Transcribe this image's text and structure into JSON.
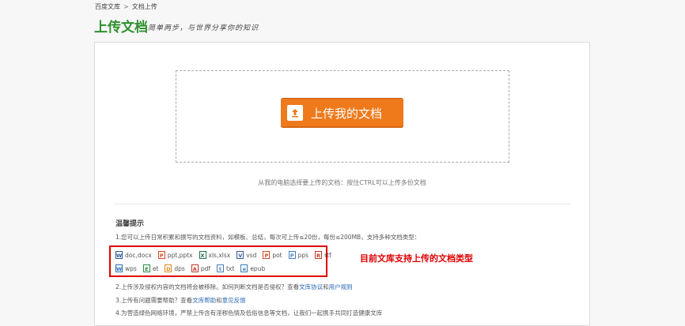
{
  "breadcrumb": {
    "home": "百度文库",
    "separator": ">",
    "current": "文档上传"
  },
  "header": {
    "title": "上传文档",
    "slogan": "简单两步，与世界分享你的知识"
  },
  "upload": {
    "button_label": "上传我的文档",
    "button_icon": "upload-arrow-icon",
    "instruction": "从我的电脑选择要上传的文档：按住CTRL可以上传多份文档"
  },
  "tips": {
    "heading": "温馨提示",
    "line1": "1.您可以上传日常积累和撰写的文档资料，如模板、总结，每次可上传≤20份，每份≤200MB，支持多种文档类型：",
    "line2_prefix": "2.上传涉及侵权内容的文档将会被移除。如何判断文档是否侵权？查看",
    "line2_link1": "文库协议",
    "line2_and": "和",
    "line2_link2": "用户规则",
    "line3_prefix": "3.上传有问题需要帮助？查看",
    "line3_link1": "文库帮助",
    "line3_and": "和",
    "line3_link2": "意见反馈",
    "line4": "4.为营造绿色网络环境，严禁上传含有淫秽色情及低俗信息等文档，让我们一起携手共同打造健康文库"
  },
  "file_types": {
    "row1": [
      {
        "label": "doc,docx",
        "icon": "word-icon",
        "glyph": "W",
        "color": "#2b5797"
      },
      {
        "label": "ppt,pptx",
        "icon": "powerpoint-icon",
        "glyph": "P",
        "color": "#d24726"
      },
      {
        "label": "xls,xlsx",
        "icon": "excel-icon",
        "glyph": "X",
        "color": "#1e7145"
      },
      {
        "label": "vsd",
        "icon": "visio-icon",
        "glyph": "V",
        "color": "#3955a3"
      },
      {
        "label": "pot",
        "icon": "pot-icon",
        "glyph": "P",
        "color": "#d24726"
      },
      {
        "label": "pps",
        "icon": "pps-icon",
        "glyph": "P",
        "color": "#4a7ebb"
      },
      {
        "label": "rtf",
        "icon": "rtf-icon",
        "glyph": "R",
        "color": "#c0392b"
      }
    ],
    "row2": [
      {
        "label": "wps",
        "icon": "wps-icon",
        "glyph": "W",
        "color": "#2b6cb0"
      },
      {
        "label": "et",
        "icon": "et-icon",
        "glyph": "E",
        "color": "#2e8b3e"
      },
      {
        "label": "dps",
        "icon": "dps-icon",
        "glyph": "D",
        "color": "#e08a1e"
      },
      {
        "label": "pdf",
        "icon": "pdf-icon",
        "glyph": "A",
        "color": "#c0392b"
      },
      {
        "label": "txt",
        "icon": "txt-icon",
        "glyph": "t",
        "color": "#4a7ebb"
      },
      {
        "label": "epub",
        "icon": "epub-icon",
        "glyph": "e",
        "color": "#3d7ab8"
      }
    ]
  },
  "annotation": {
    "callout": "目前文库支持上传的文档类型"
  },
  "colors": {
    "accent_green": "#2f8f2f",
    "button_orange": "#ee7a1c",
    "highlight_red": "#e00000",
    "link_blue": "#2a68b8"
  }
}
